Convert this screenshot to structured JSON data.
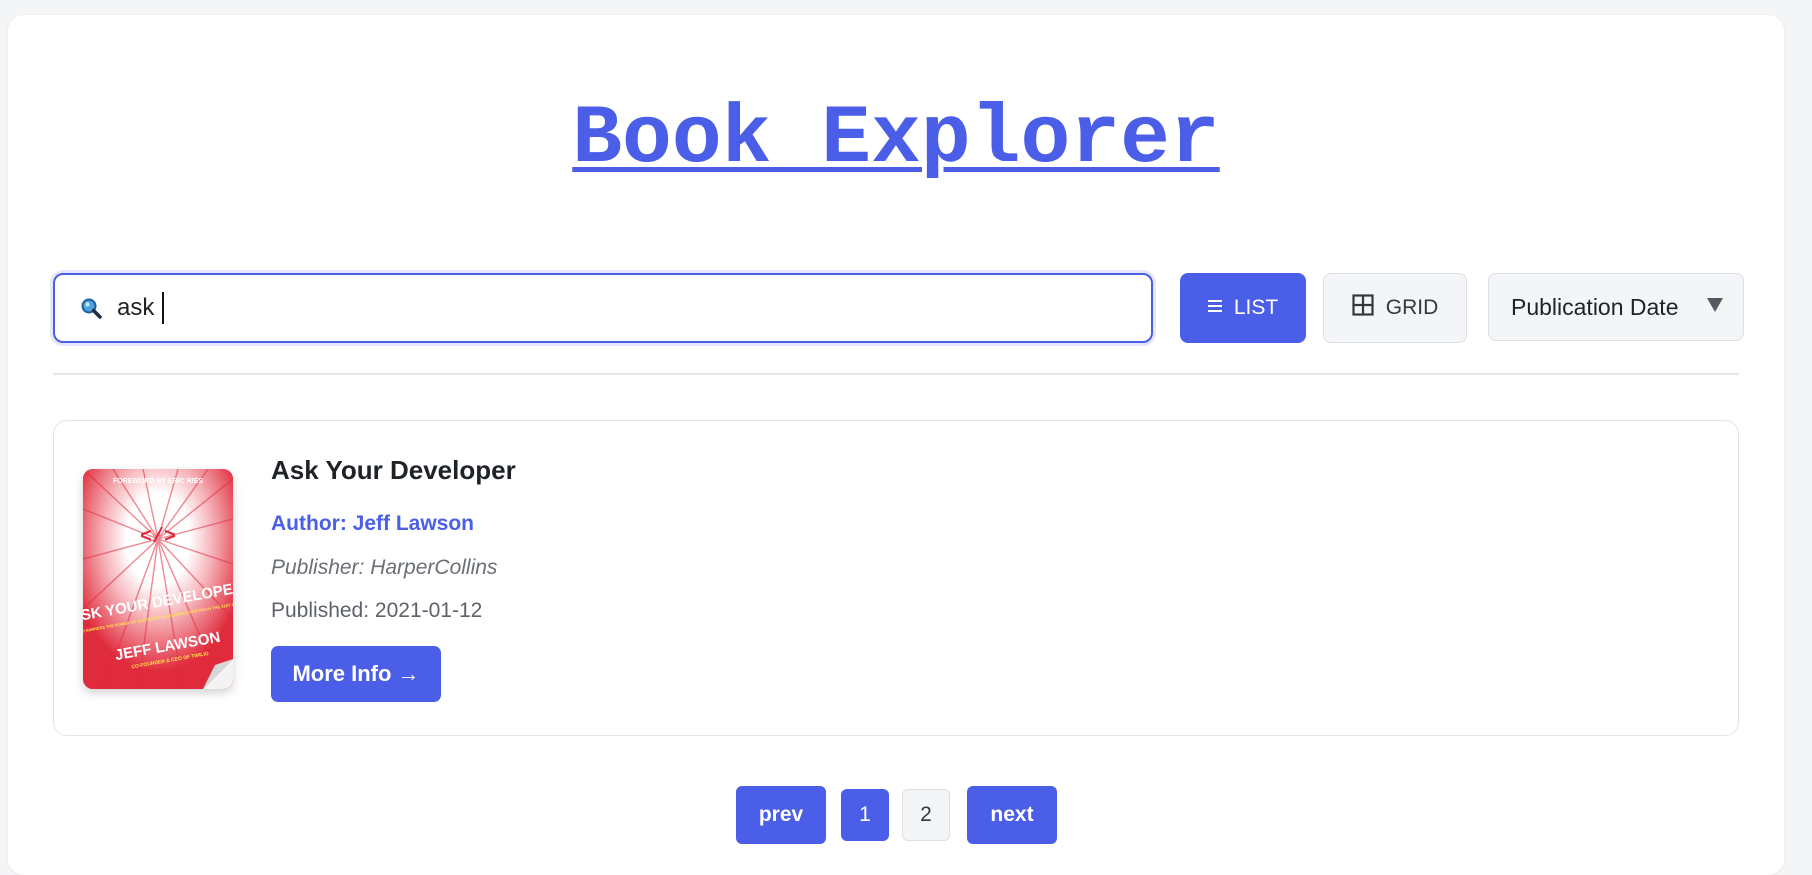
{
  "header": {
    "title": "Book Explorer"
  },
  "search": {
    "value": "ask",
    "icon": "search-icon"
  },
  "view_toggle": {
    "list_label": "LIST",
    "grid_label": "GRID",
    "active": "list"
  },
  "sort": {
    "selected": "Publication Date"
  },
  "results": [
    {
      "title": "Ask Your Developer",
      "author": "Author: Jeff Lawson",
      "publisher": "Publisher: HarperCollins",
      "published": "Published: 2021-01-12",
      "more_label": "More Info →",
      "cover": {
        "foreword": "FOREWORD BY ERIC RIES",
        "code_symbol": "</>",
        "title_text": "ASK YOUR DEVELOPER",
        "subtitle": "HOW TO HARNESS THE POWER OF SOFTWARE DEVELOPERS AND WIN IN THE 21ST CENTURY",
        "author": "JEFF LAWSON",
        "author_note": "CO-FOUNDER & CEO OF TWILIO"
      }
    }
  ],
  "pagination": {
    "prev_label": "prev",
    "next_label": "next",
    "pages": [
      "1",
      "2"
    ],
    "current": "1"
  },
  "colors": {
    "accent": "#4a5ee8",
    "cover_red": "#e02b3c"
  }
}
